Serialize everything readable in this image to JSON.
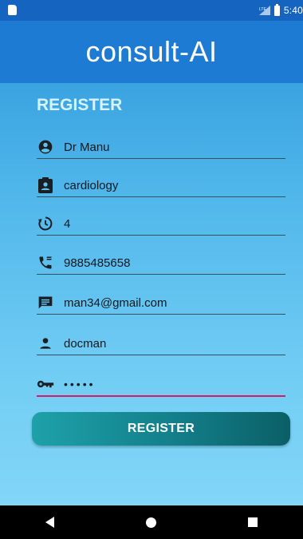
{
  "status_bar": {
    "time": "5:40",
    "network_label": "LTE"
  },
  "app_bar": {
    "title": "consult-AI"
  },
  "form": {
    "heading": "REGISTER",
    "fields": [
      {
        "icon": "account-circle-icon",
        "value": "Dr Manu"
      },
      {
        "icon": "badge-icon",
        "value": "cardiology"
      },
      {
        "icon": "history-icon",
        "value": "4"
      },
      {
        "icon": "phone-icon",
        "value": "9885485658"
      },
      {
        "icon": "message-icon",
        "value": "man34@gmail.com"
      },
      {
        "icon": "person-icon",
        "value": "docman"
      },
      {
        "icon": "key-icon",
        "value": "•••••"
      }
    ],
    "submit_label": "REGISTER"
  },
  "colors": {
    "app_bar": "#1e7bd4",
    "status_bar": "#1565c0",
    "heading": "#d6f3ff",
    "button_start": "#1ea1a9",
    "button_end": "#0b5f66",
    "active_underline": "#d11b6d"
  },
  "nav_bar": {
    "back": "back-triangle-icon",
    "home": "home-circle-icon",
    "recents": "recents-square-icon"
  }
}
